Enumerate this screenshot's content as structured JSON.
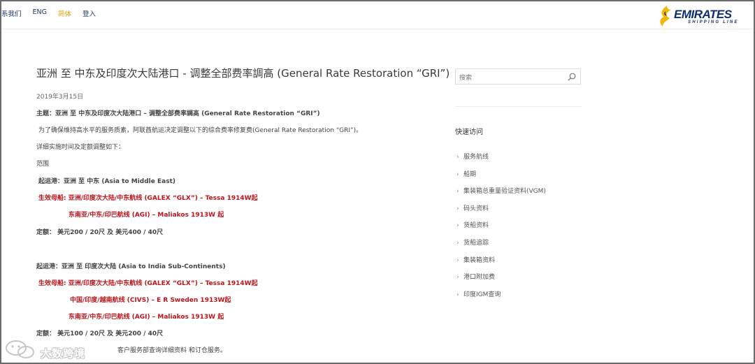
{
  "topnav": {
    "items": [
      "系我们",
      "ENG",
      "简体",
      "登入"
    ],
    "active_index": 2
  },
  "logo": {
    "wordmark": "EMIRATES",
    "tagline": "SHIPPING LINE"
  },
  "article": {
    "title": "亚洲 至 中东及印度次大陆港口 - 调整全部费率調高 (General Rate Restoration “GRI”)",
    "date": "2019年3月15日",
    "subject": "主题：亚洲 至 中东及印度次大陆港口 – 调整全部费率調高 (General Rate Restoration “GRI”)",
    "intro": "为了确保维持高水平的服务质素，阿联酋航运决定调整以下的综合费率修复费(General Rate Restoration “GRI”)。",
    "details_heading": "详细实施时间及定额调整如下：",
    "scope_label": "范围",
    "sections": [
      {
        "origin": "起运港：亚洲 至 中东 (Asia to Middle East)",
        "effective_lines": [
          "生效母船: 亚洲/印度次大陆/中东航线 (GALEX “GLX”) – Tessa 1914W起",
          "东南亚/中东/印巴航线 (AGI) – Maliakos 1913W 起"
        ],
        "amount": "定额：  美元200 / 20尺 及 美元400 / 40尺"
      },
      {
        "origin": "起运港：亚洲 至 印度次大陆 (Asia to India Sub-Continents)",
        "effective_lines": [
          "生效母船: 亚洲/印度次大陆/中东航线 (GALEX “GLX”) – Tessa 1914W起",
          "中国/印度/越南航线 (CIVS)  – E R Sweden 1913W起",
          "东南亚/中东/印巴航线 (AGI) – Maliakos 1913W 起"
        ],
        "amount": "定额：  美元100 / 20尺 及 美元200 / 40尺"
      }
    ],
    "footer_partial": "客户服务部查询详细资料 和订仓服务。"
  },
  "sidebar": {
    "search_placeholder": "搜索",
    "quick_access_title": "快速访问",
    "links": [
      "服务航线",
      "船期",
      "集装箱总重量验证资料(VGM)",
      "码头资料",
      "货船资料",
      "货船追踪",
      "集装箱资料",
      "港口附加费",
      "印度IGM查询"
    ]
  },
  "watermark": {
    "text": "大数跨境"
  },
  "colors": {
    "accent_red": "#c0141c",
    "nav_active": "#e0a010",
    "brand_blue": "#0d2f6e",
    "logo_yellow": "#f2b705"
  },
  "icons": {
    "search": "search-icon",
    "logo_mark": "emirates-flame-icon",
    "chevron": "chevron-right-icon"
  }
}
